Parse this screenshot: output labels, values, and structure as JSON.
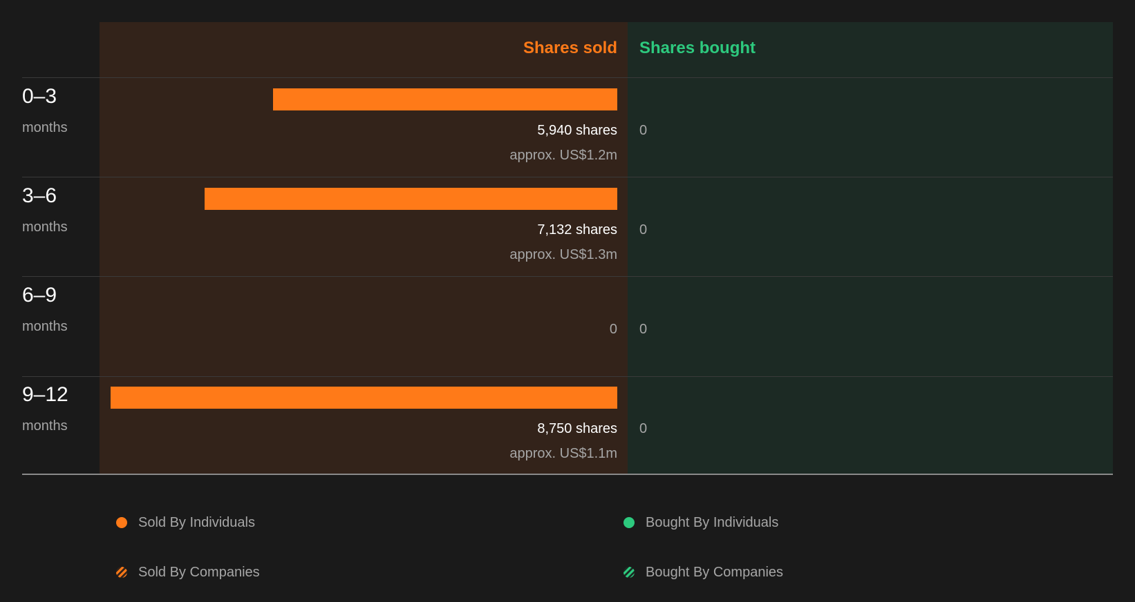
{
  "chart_data": {
    "type": "bar",
    "orientation": "horizontal-diverging",
    "headers": {
      "sold": "Shares sold",
      "bought": "Shares bought"
    },
    "unit_label": "months",
    "categories": [
      "0–3",
      "3–6",
      "6–9",
      "9–12"
    ],
    "series": [
      {
        "name": "Shares sold",
        "values": [
          5940,
          7132,
          0,
          8750
        ]
      },
      {
        "name": "Shares bought",
        "values": [
          0,
          0,
          0,
          0
        ]
      }
    ],
    "rows": [
      {
        "period": "0–3",
        "unit": "months",
        "sold_label": "5,940 shares",
        "sold_value_label": "approx. US$1.2m",
        "bought_label": "0"
      },
      {
        "period": "3–6",
        "unit": "months",
        "sold_label": "7,132 shares",
        "sold_value_label": "approx. US$1.3m",
        "bought_label": "0"
      },
      {
        "period": "6–9",
        "unit": "months",
        "sold_label": "0",
        "sold_value_label": "",
        "bought_label": "0"
      },
      {
        "period": "9–12",
        "unit": "months",
        "sold_label": "8,750 shares",
        "sold_value_label": "approx. US$1.1m",
        "bought_label": "0"
      }
    ],
    "xlim": [
      0,
      8750
    ],
    "legend": [
      {
        "label": "Sold By Individuals",
        "swatch": "solid",
        "color": "#ff7a18"
      },
      {
        "label": "Bought By Individuals",
        "swatch": "solid",
        "color": "#2dc97e"
      },
      {
        "label": "Sold By Companies",
        "swatch": "hatched",
        "color": "#ff7a18"
      },
      {
        "label": "Bought By Companies",
        "swatch": "hatched",
        "color": "#2dc97e"
      }
    ],
    "legend_placement": "bottom",
    "colors": {
      "sold": "#ff7a18",
      "bought": "#2dc97e"
    }
  }
}
